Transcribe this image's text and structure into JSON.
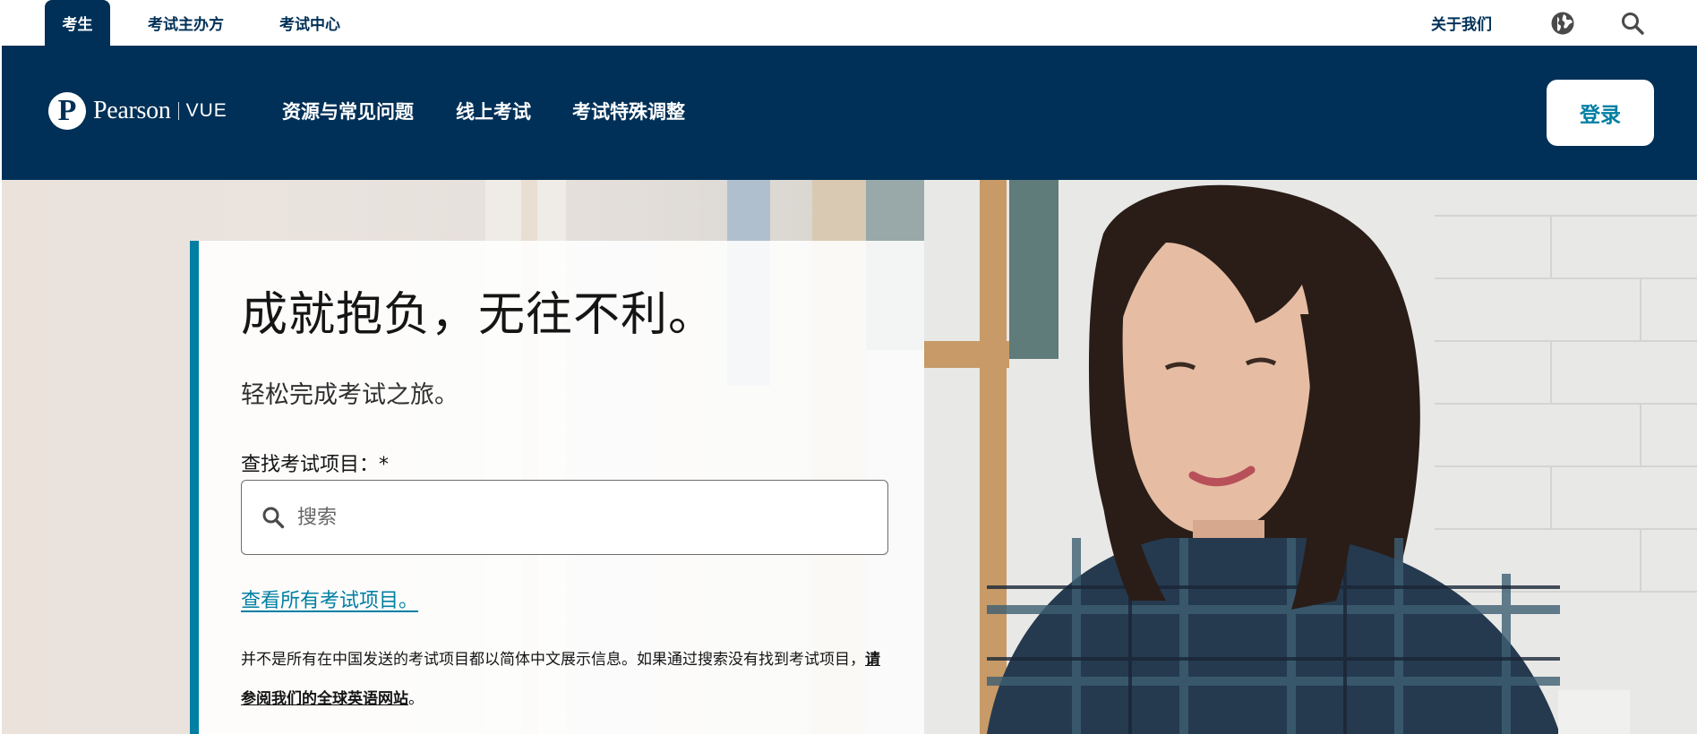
{
  "utility_bar": {
    "tabs": [
      {
        "label": "考生",
        "active": true
      },
      {
        "label": "考试主办方",
        "active": false
      },
      {
        "label": "考试中心",
        "active": false
      }
    ],
    "about_label": "关于我们",
    "globe_icon": "globe-icon",
    "search_icon": "search-icon"
  },
  "header": {
    "logo": {
      "brand": "Pearson",
      "product": "VUE"
    },
    "nav": [
      "资源与常见问题",
      "线上考试",
      "考试特殊调整"
    ],
    "login_label": "登录"
  },
  "hero": {
    "title": "成就抱负，无往不利。",
    "subtitle": "轻松完成考试之旅。",
    "search": {
      "label": "查找考试项目：*",
      "placeholder": "搜索",
      "value": ""
    },
    "all_programs_link": "查看所有考试项目。",
    "note_text": "并不是所有在中国发送的考试项目都以简体中文展示信息。如果通过搜索没有找到考试项目，",
    "note_link": "请参阅我们的全球英语网站",
    "note_end": "。"
  },
  "colors": {
    "brand_navy": "#003057",
    "accent_teal": "#007fa3",
    "white": "#ffffff"
  }
}
